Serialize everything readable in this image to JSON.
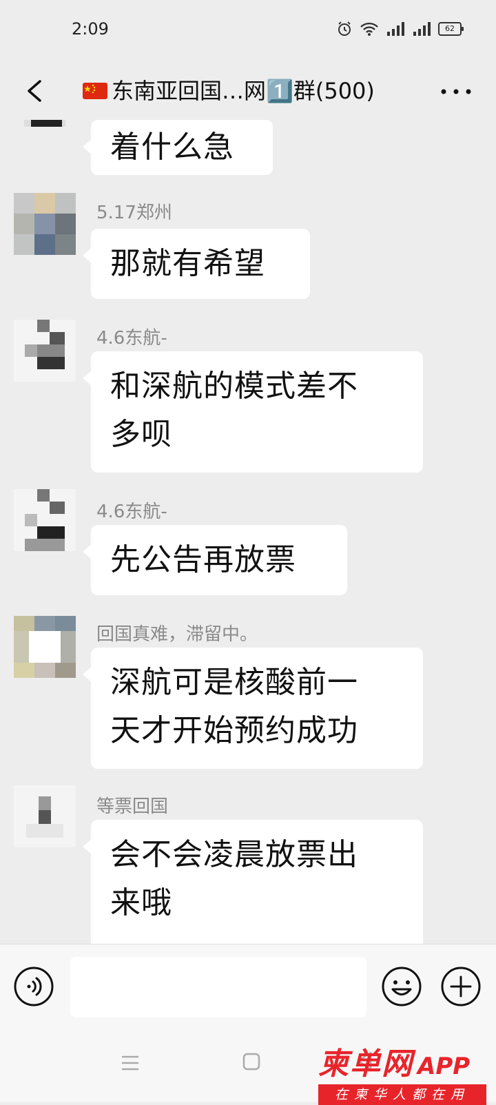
{
  "status": {
    "time": "2:09",
    "battery": "62"
  },
  "header": {
    "title": "东南亚回国…网1️⃣群(500)",
    "back_icon": "back-icon",
    "more_icon": "more-icon"
  },
  "messages": [
    {
      "nick": "",
      "text": "着什么急"
    },
    {
      "nick": "5.17郑州",
      "text": "那就有希望"
    },
    {
      "nick": "4.6东航-",
      "line1": "和深航的模式差不",
      "line2": "多呗"
    },
    {
      "nick": "4.6东航-",
      "text": "先公告再放票"
    },
    {
      "nick": "回国真难，滞留中。",
      "line1": "深航可是核酸前一",
      "line2": "天才开始预约成功"
    },
    {
      "nick": "等票回国",
      "line1": "会不会凌晨放票出",
      "line2": "来哦"
    }
  ],
  "input": {
    "placeholder": ""
  },
  "watermark": {
    "logo": "柬单网",
    "app": "APP",
    "slogan": "在柬华人都在用"
  },
  "colors": {
    "background": "#ededed",
    "bubble": "#ffffff",
    "nickname": "#8a8a8a",
    "brand_red": "#e8242b"
  }
}
